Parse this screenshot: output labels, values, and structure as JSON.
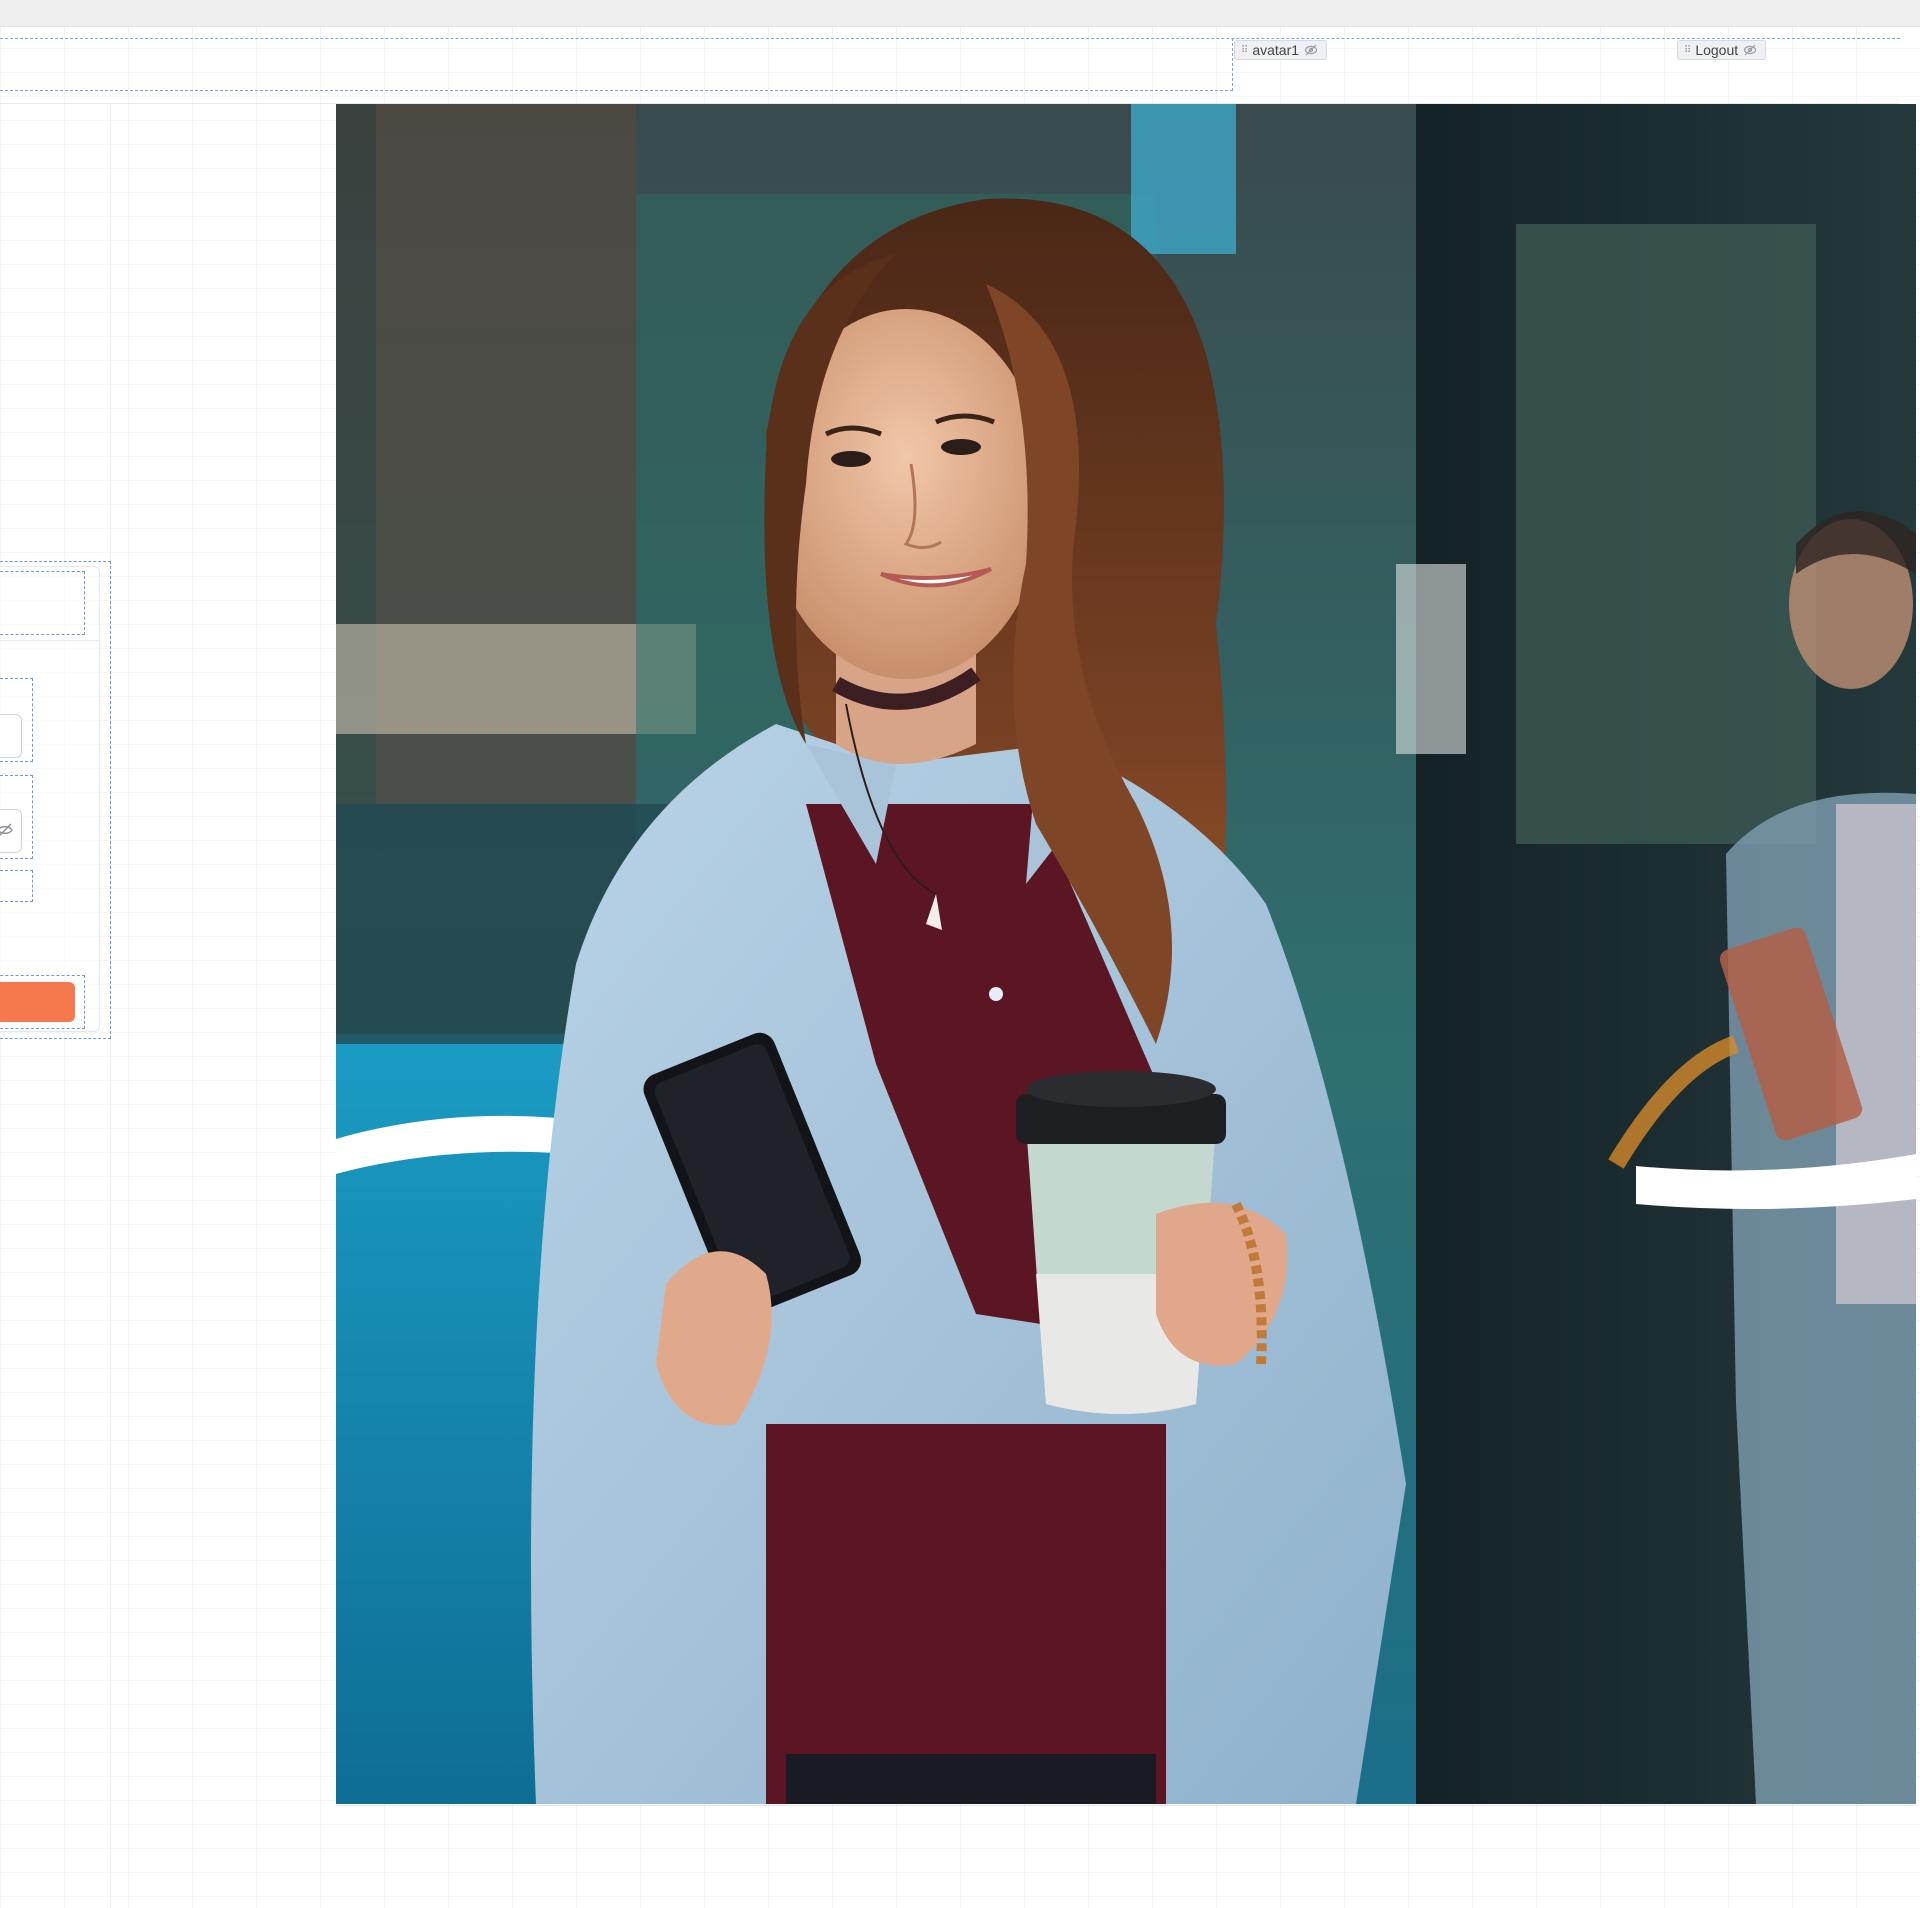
{
  "header": {
    "layers": [
      {
        "label": "avatar1"
      },
      {
        "label": "Logout"
      }
    ]
  },
  "form": {
    "submit_color": "#f5794d",
    "hide_password_icon": "eye-off-icon"
  },
  "hero": {
    "kind": "photo",
    "subject": "woman holding phone and coffee cup in front of bus",
    "wave_color": "#ffffff"
  },
  "colors": {
    "selection_outline": "#6f98d6",
    "layer_tag_bg": "#eef0f3"
  }
}
